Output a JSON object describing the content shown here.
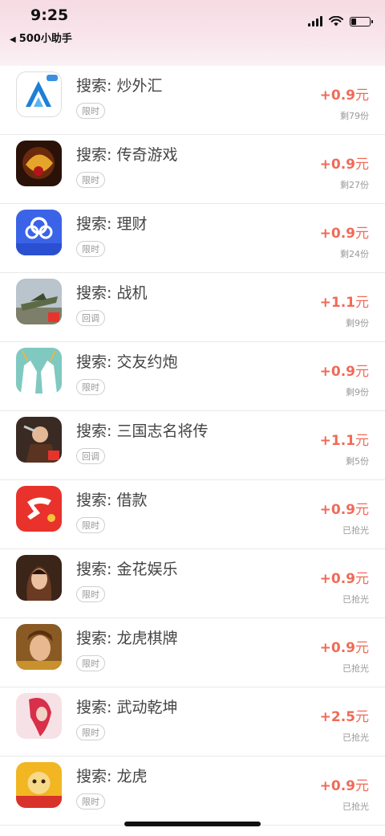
{
  "status_bar": {
    "time": "9:25",
    "back_app": "500小助手",
    "battery_level": 0.3
  },
  "tasks": [
    {
      "title": "搜索: 炒外汇",
      "tag": "限时",
      "reward_prefix": "+",
      "reward_amount": "0.9",
      "reward_unit": "元",
      "remaining": "剩79份",
      "icon": "forex-app-icon"
    },
    {
      "title": "搜索: 传奇游戏",
      "tag": "限时",
      "reward_prefix": "+",
      "reward_amount": "0.9",
      "reward_unit": "元",
      "remaining": "剩27份",
      "icon": "legend-game-icon"
    },
    {
      "title": "搜索: 理财",
      "tag": "限时",
      "reward_prefix": "+",
      "reward_amount": "0.9",
      "reward_unit": "元",
      "remaining": "剩24份",
      "icon": "finance-app-icon",
      "icon_caption": "国资背景"
    },
    {
      "title": "搜索: 战机",
      "tag": "回调",
      "reward_prefix": "+",
      "reward_amount": "1.1",
      "reward_unit": "元",
      "remaining": "剩9份",
      "icon": "warplane-game-icon"
    },
    {
      "title": "搜索: 交友约炮",
      "tag": "限时",
      "reward_prefix": "+",
      "reward_amount": "0.9",
      "reward_unit": "元",
      "remaining": "剩9份",
      "icon": "dating-app-icon"
    },
    {
      "title": "搜索: 三国志名将传",
      "tag": "回调",
      "reward_prefix": "+",
      "reward_amount": "1.1",
      "reward_unit": "元",
      "remaining": "剩5份",
      "icon": "three-kingdoms-game-icon"
    },
    {
      "title": "搜索: 借款",
      "tag": "限时",
      "reward_prefix": "+",
      "reward_amount": "0.9",
      "reward_unit": "元",
      "remaining": "已抢光",
      "icon": "loan-app-icon"
    },
    {
      "title": "搜索: 金花娱乐",
      "tag": "限时",
      "reward_prefix": "+",
      "reward_amount": "0.9",
      "reward_unit": "元",
      "remaining": "已抢光",
      "icon": "card-game-icon"
    },
    {
      "title": "搜索: 龙虎棋牌",
      "tag": "限时",
      "reward_prefix": "+",
      "reward_amount": "0.9",
      "reward_unit": "元",
      "remaining": "已抢光",
      "icon": "chess-card-game-icon"
    },
    {
      "title": "搜索: 武动乾坤",
      "tag": "限时",
      "reward_prefix": "+",
      "reward_amount": "2.5",
      "reward_unit": "元",
      "remaining": "已抢光",
      "icon": "martial-game-icon"
    },
    {
      "title": "搜索: 龙虎",
      "tag": "限时",
      "reward_prefix": "+",
      "reward_amount": "0.9",
      "reward_unit": "元",
      "remaining": "已抢光",
      "icon": "dragon-tiger-game-icon"
    }
  ]
}
